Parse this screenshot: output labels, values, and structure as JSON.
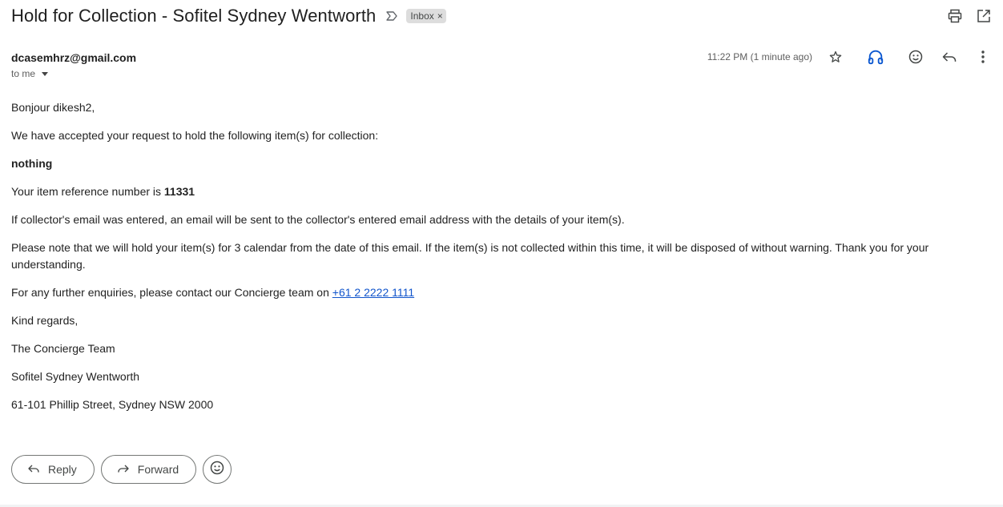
{
  "email": {
    "subject": "Hold for Collection - Sofitel Sydney Wentworth",
    "label": "Inbox",
    "label_remove": "×",
    "sender": "dcasemhrz@gmail.com",
    "recipient": "to me",
    "timestamp": "11:22 PM (1 minute ago)"
  },
  "icons": {
    "importance": "importance-marker-icon",
    "print": "print-icon",
    "popout": "open-in-new-window-icon",
    "star": "star-icon",
    "audio": "headphones-icon",
    "emoji": "add-reaction-icon",
    "reply": "reply-icon",
    "more": "more-vertical-icon"
  },
  "body": {
    "greeting": "Bonjour dikesh2,",
    "accepted": "We have accepted your request to hold the following item(s) for collection:",
    "item": "nothing",
    "reference_prefix": "Your item reference number is ",
    "reference_number": "11331",
    "collector_note": "If collector's email was entered, an email will be sent to the collector's entered email address with the details of your item(s).",
    "hold_note": "Please note that we will hold your item(s) for 3 calendar from the date of this email. If the item(s) is not collected within this time, it will be disposed of without warning. Thank you for your understanding.",
    "enquiries_prefix": "For any further enquiries, please contact our Concierge team on ",
    "phone": "+61 2 2222 1111",
    "regards": "Kind regards,",
    "team": "The Concierge Team",
    "hotel": "Sofitel Sydney Wentworth",
    "address": "61-101 Phillip Street, Sydney NSW 2000"
  },
  "actions": {
    "reply": "Reply",
    "forward": "Forward"
  },
  "colors": {
    "link": "#1155cc",
    "audio_icon": "#0b57d0",
    "chip_bg": "#dddddd"
  }
}
